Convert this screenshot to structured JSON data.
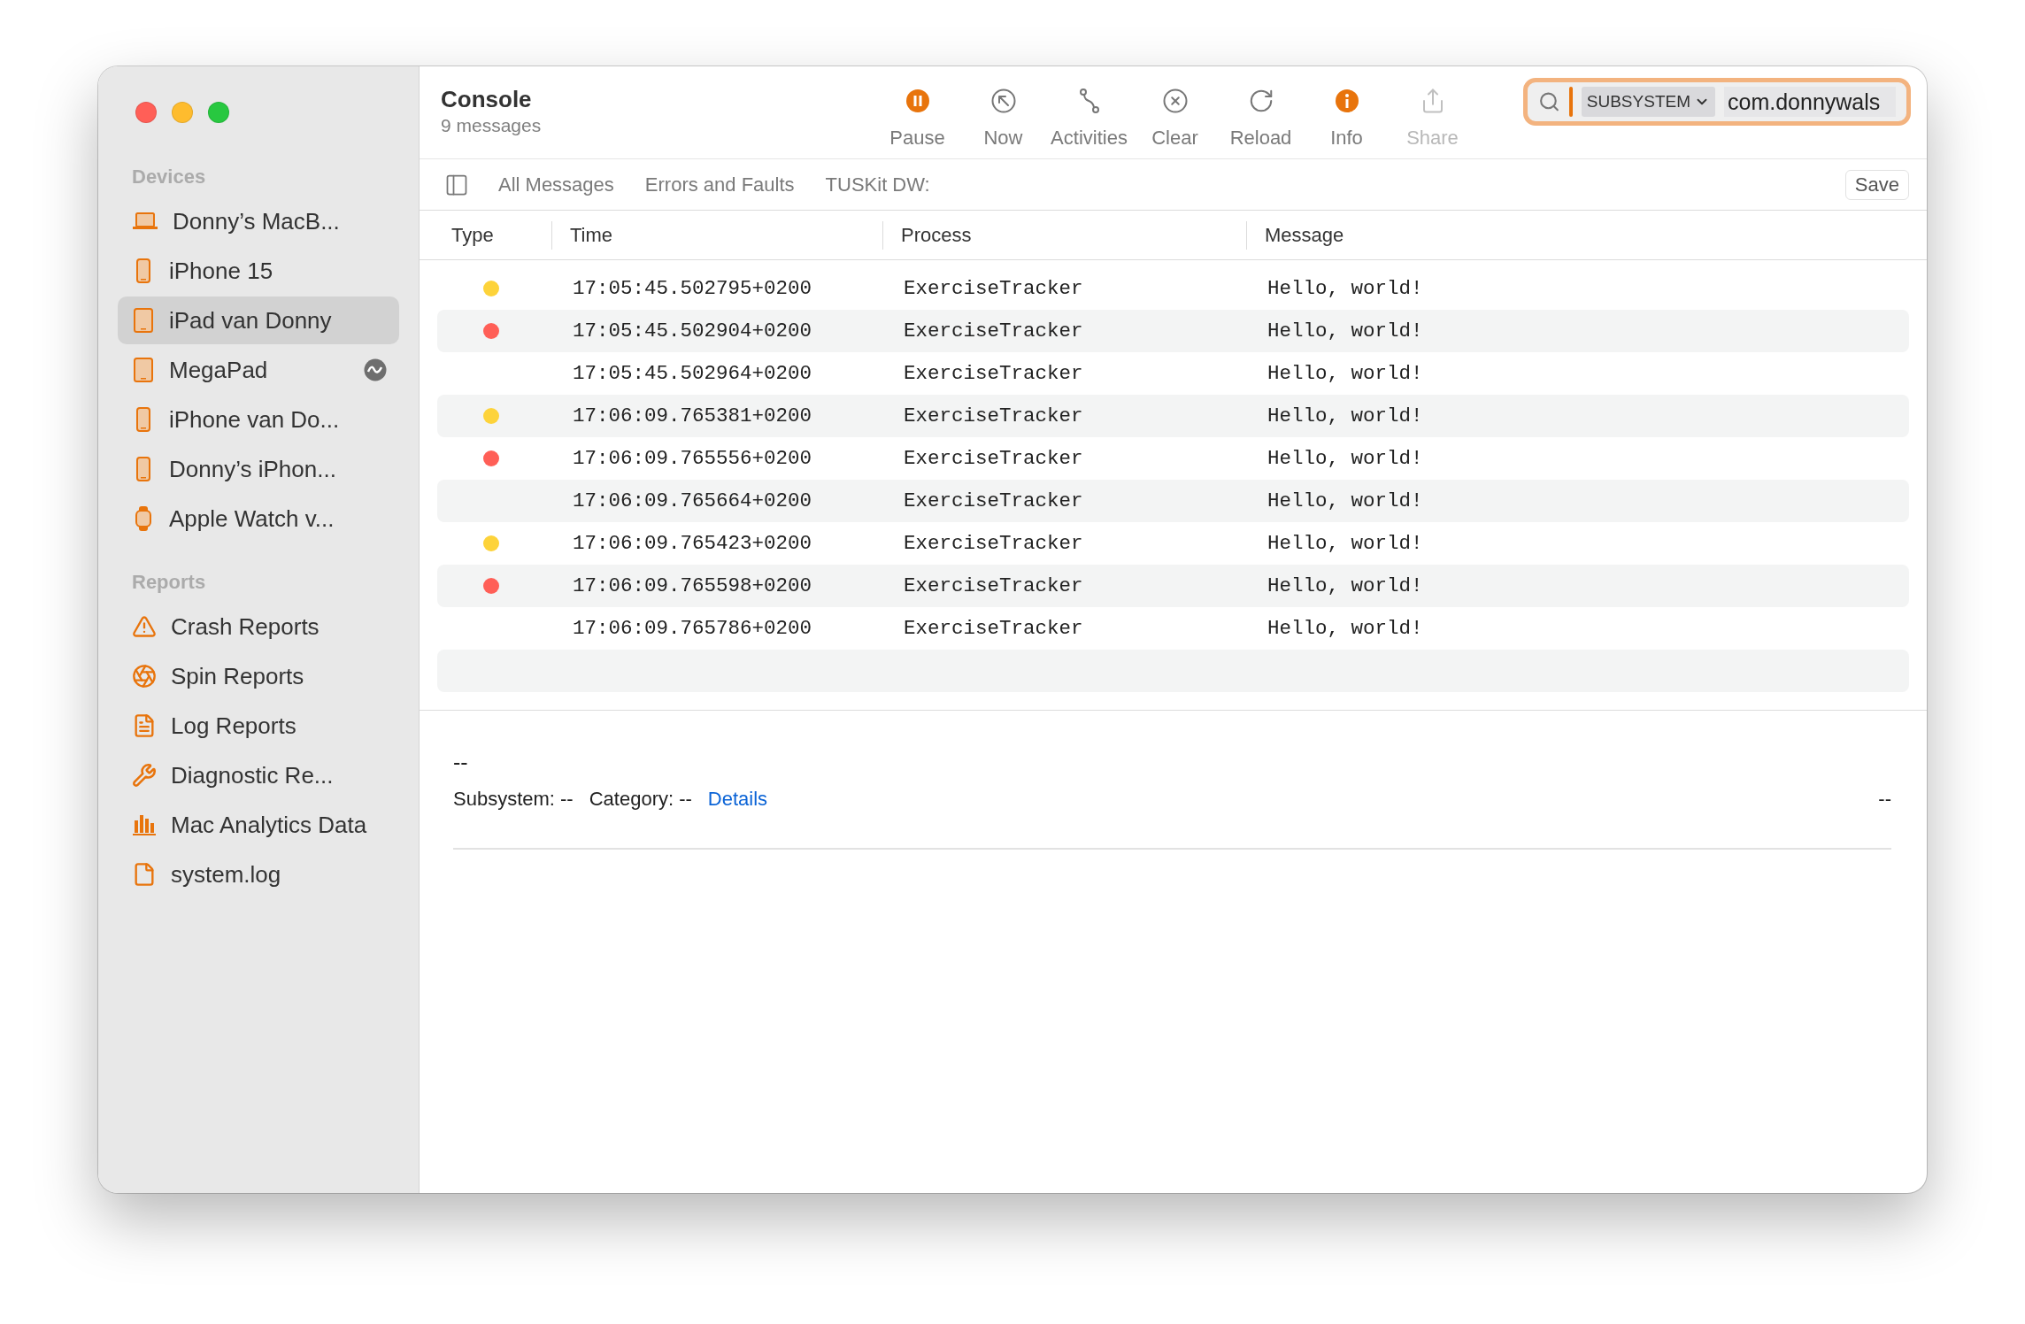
{
  "window": {
    "title": "Console",
    "subtitle": "9 messages"
  },
  "sidebar": {
    "sections": [
      {
        "title": "Devices",
        "items": [
          {
            "label": "Donny’s MacB...",
            "kind": "laptop",
            "selected": false
          },
          {
            "label": "iPhone 15",
            "kind": "phone",
            "selected": false
          },
          {
            "label": "iPad van Donny",
            "kind": "tablet",
            "selected": true
          },
          {
            "label": "MegaPad",
            "kind": "tablet",
            "selected": false,
            "streaming": true
          },
          {
            "label": "iPhone van Do...",
            "kind": "phone",
            "selected": false
          },
          {
            "label": "Donny’s iPhon...",
            "kind": "phone",
            "selected": false
          },
          {
            "label": "Apple Watch v...",
            "kind": "watch",
            "selected": false
          }
        ]
      },
      {
        "title": "Reports",
        "items": [
          {
            "label": "Crash Reports",
            "kind": "warning",
            "selected": false
          },
          {
            "label": "Spin Reports",
            "kind": "spin",
            "selected": false
          },
          {
            "label": "Log Reports",
            "kind": "log",
            "selected": false
          },
          {
            "label": "Diagnostic Re...",
            "kind": "tools",
            "selected": false
          },
          {
            "label": "Mac Analytics Data",
            "kind": "chart",
            "selected": false
          },
          {
            "label": "system.log",
            "kind": "file",
            "selected": false
          }
        ]
      }
    ]
  },
  "toolbar": [
    {
      "label": "Pause",
      "kind": "pause",
      "on": true,
      "disabled": false
    },
    {
      "label": "Now",
      "kind": "now",
      "on": false,
      "disabled": false
    },
    {
      "label": "Activities",
      "kind": "activities",
      "on": false,
      "disabled": false
    },
    {
      "label": "Clear",
      "kind": "clear",
      "on": false,
      "disabled": false
    },
    {
      "label": "Reload",
      "kind": "reload",
      "on": false,
      "disabled": false
    },
    {
      "label": "Info",
      "kind": "info",
      "on": true,
      "disabled": false
    },
    {
      "label": "Share",
      "kind": "share",
      "on": false,
      "disabled": true
    }
  ],
  "search": {
    "token": "SUBSYSTEM",
    "value": "com.donnywals",
    "focused": true
  },
  "filters": [
    {
      "label": "All Messages",
      "selected": false
    },
    {
      "label": "Errors and Faults",
      "selected": false
    },
    {
      "label": "TUSKit DW:",
      "selected": false
    }
  ],
  "save_button": "Save",
  "table": {
    "columns": [
      "Type",
      "Time",
      "Process",
      "Message"
    ],
    "rows": [
      {
        "color": "#fdd33a",
        "time": "17:05:45.502795+0200",
        "process": "ExerciseTracker",
        "message": "Hello, world!"
      },
      {
        "color": "#ff5f57",
        "time": "17:05:45.502904+0200",
        "process": "ExerciseTracker",
        "message": "Hello, world!"
      },
      {
        "time": "17:05:45.502964+0200",
        "process": "ExerciseTracker",
        "message": "Hello, world!"
      },
      {
        "color": "#fdd33a",
        "time": "17:06:09.765381+0200",
        "process": "ExerciseTracker",
        "message": "Hello, world!"
      },
      {
        "color": "#ff5f57",
        "time": "17:06:09.765556+0200",
        "process": "ExerciseTracker",
        "message": "Hello, world!"
      },
      {
        "time": "17:06:09.765664+0200",
        "process": "ExerciseTracker",
        "message": "Hello, world!"
      },
      {
        "color": "#fdd33a",
        "time": "17:06:09.765423+0200",
        "process": "ExerciseTracker",
        "message": "Hello, world!"
      },
      {
        "color": "#ff5f57",
        "time": "17:06:09.765598+0200",
        "process": "ExerciseTracker",
        "message": "Hello, world!"
      },
      {
        "time": "17:06:09.765786+0200",
        "process": "ExerciseTracker",
        "message": "Hello, world!"
      }
    ]
  },
  "detail": {
    "title": "--",
    "subsystem": "Subsystem: --",
    "category": "Category: --",
    "link": "Details",
    "right": "--"
  }
}
